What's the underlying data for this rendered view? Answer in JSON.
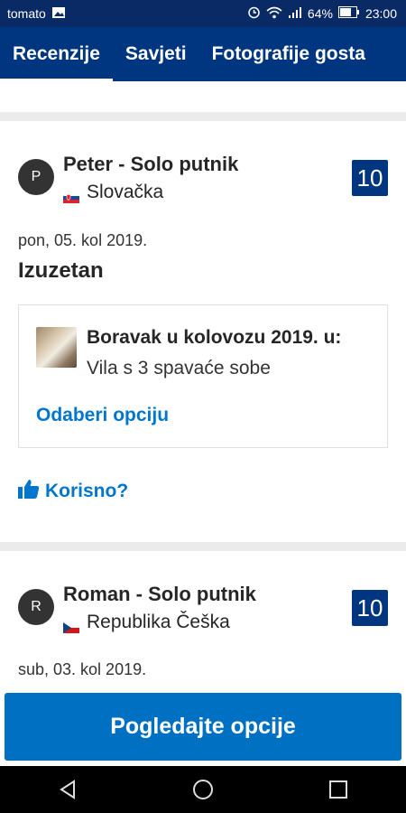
{
  "status_bar": {
    "carrier": "tomato",
    "battery": "64%",
    "time": "23:00"
  },
  "tabs": [
    {
      "label": "Recenzije"
    },
    {
      "label": "Savjeti"
    },
    {
      "label": "Fotografije gosta"
    }
  ],
  "reviews": [
    {
      "avatar_letter": "P",
      "name": "Peter - Solo putnik",
      "country": "Slovačka",
      "score": "10",
      "date": "pon, 05. kol 2019.",
      "title": "Izuzetan",
      "stay_title": "Boravak u kolovozu 2019. u:",
      "stay_room": "Vila s 3 spavaće sobe",
      "stay_link": "Odaberi opciju",
      "helpful": "Korisno?"
    },
    {
      "avatar_letter": "R",
      "name": "Roman - Solo putnik",
      "country": "Republika Češka",
      "score": "10",
      "date": "sub, 03. kol 2019."
    }
  ],
  "cta": {
    "label": "Pogledajte opcije"
  },
  "colors": {
    "brand": "#003580",
    "link": "#0077cc",
    "cta": "#0071c2"
  }
}
